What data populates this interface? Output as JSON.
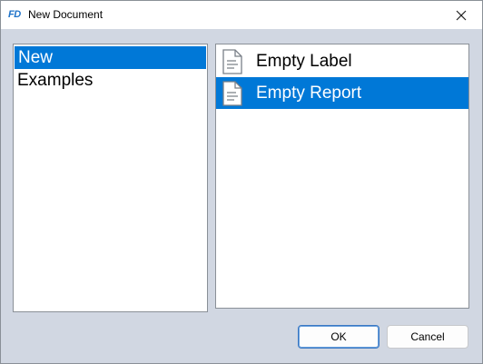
{
  "window": {
    "app_icon_text": "FD",
    "title": "New Document",
    "close_icon": "close-icon"
  },
  "categories": {
    "items": [
      {
        "label": "New",
        "selected": true
      },
      {
        "label": "Examples",
        "selected": false
      }
    ]
  },
  "documents": {
    "items": [
      {
        "label": "Empty Label",
        "icon": "document-icon",
        "selected": false
      },
      {
        "label": "Empty Report",
        "icon": "document-icon",
        "selected": true
      }
    ]
  },
  "buttons": {
    "ok_label": "OK",
    "cancel_label": "Cancel"
  },
  "colors": {
    "selection": "#0078d7",
    "dialog_background": "#d1d7e2",
    "app_icon": "#1f73c9"
  }
}
